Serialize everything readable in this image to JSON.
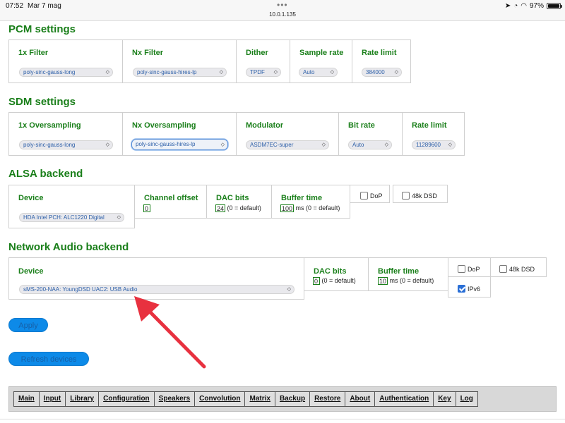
{
  "status_bar": {
    "time": "07:52",
    "date": "Mar 7 mag",
    "url": "10.0.1.135",
    "battery": "97%",
    "battery_level": 0.97
  },
  "pcm": {
    "title": "PCM settings",
    "filter_1x": {
      "label": "1x Filter",
      "value": "poly-sinc-gauss-long"
    },
    "filter_nx": {
      "label": "Nx Filter",
      "value": "poly-sinc-gauss-hires-lp"
    },
    "dither": {
      "label": "Dither",
      "value": "TPDF"
    },
    "sample_rate": {
      "label": "Sample rate",
      "value": "Auto"
    },
    "rate_limit": {
      "label": "Rate limit",
      "value": "384000"
    }
  },
  "sdm": {
    "title": "SDM settings",
    "oversampling_1x": {
      "label": "1x Oversampling",
      "value": "poly-sinc-gauss-long"
    },
    "oversampling_nx": {
      "label": "Nx Oversampling",
      "value": "poly-sinc-gauss-hires-lp"
    },
    "modulator": {
      "label": "Modulator",
      "value": "ASDM7EC-super"
    },
    "bit_rate": {
      "label": "Bit rate",
      "value": "Auto"
    },
    "rate_limit": {
      "label": "Rate limit",
      "value": "11289600"
    }
  },
  "alsa": {
    "title": "ALSA backend",
    "device": {
      "label": "Device",
      "value": "HDA Intel PCH: ALC1220 Digital"
    },
    "channel_offset": {
      "label": "Channel offset",
      "value": "0"
    },
    "dac_bits": {
      "label": "DAC bits",
      "value": "24",
      "hint": "(0 = default)"
    },
    "buffer_time": {
      "label": "Buffer time",
      "value": "100",
      "hint": "ms (0 = default)"
    },
    "dop": {
      "label": "DoP",
      "checked": false
    },
    "dsd48k": {
      "label": "48k DSD",
      "checked": false
    }
  },
  "network": {
    "title": "Network Audio backend",
    "device": {
      "label": "Device",
      "value": "sMS-200-NAA: YoungDSD UAC2: USB Audio"
    },
    "dac_bits": {
      "label": "DAC bits",
      "value": "0",
      "hint": "(0 = default)"
    },
    "buffer_time": {
      "label": "Buffer time",
      "value": "10",
      "hint": "ms (0 = default)"
    },
    "dop": {
      "label": "DoP",
      "checked": false
    },
    "dsd48k": {
      "label": "48k DSD",
      "checked": false
    },
    "ipv6": {
      "label": "IPv6",
      "checked": true
    }
  },
  "buttons": {
    "apply": "Apply",
    "refresh": "Refresh devices"
  },
  "nav": [
    "Main",
    "Input",
    "Library",
    "Configuration",
    "Speakers",
    "Convolution",
    "Matrix",
    "Backup",
    "Restore",
    "About",
    "Authentication",
    "Key",
    "Log"
  ],
  "colors": {
    "heading": "#1a7f1a",
    "button": "#0d8ae8",
    "annotation_arrow": "#e8313f"
  }
}
